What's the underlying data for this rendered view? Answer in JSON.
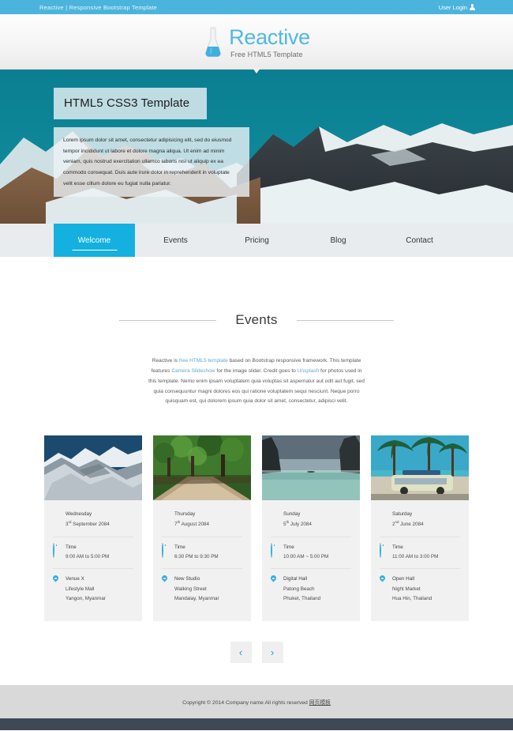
{
  "topbar": {
    "tagline": "Reactive | Responsive Bootstrap Template",
    "login_label": "User Login",
    "login_icon": "user-icon",
    "bg_color": "#4BB4DC"
  },
  "header": {
    "logo_icon": "flask-icon",
    "brand": "Reactive",
    "tagline": "Free HTML5 Template",
    "brand_color": "#4FB8E4"
  },
  "hero": {
    "caption_title": "HTML5 CSS3 Template",
    "caption_body": "Lorem ipsum dolor sit amet, consectetur adipisicing elit, sed do eiusmod tempor incididunt ut labore et dolore magna aliqua. Ut enim ad minim veniam, quis nostrud exercitation ullamco laboris nisi ut aliquip ex ea commodo consequat. Duis aute irure dolor in reprehenderit in voluptate velit esse cillum dolore eu fugiat nulla pariatur.",
    "image_alt": "snowy-mountain-range"
  },
  "nav": {
    "active_color": "#14B1E0",
    "items": [
      {
        "label": "Welcome",
        "active": true
      },
      {
        "label": "Events",
        "active": false
      },
      {
        "label": "Pricing",
        "active": false
      },
      {
        "label": "Blog",
        "active": false
      },
      {
        "label": "Contact",
        "active": false
      }
    ]
  },
  "events": {
    "title": "Events",
    "intro_parts": {
      "p1": "Reactive is ",
      "link1": "free HTML5 template",
      "p2": " based on Bootstrap responsive framework. This template features ",
      "link2": "Camera Slideshow",
      "p3": " for the image slider. Credit goes to ",
      "link3": "Unsplash",
      "p4": " for photos used in this template. Nemo enim ipsam voluptatem quia voluptas sit aspernatur aut odit aut fugit, sed quia consequuntur magni dolores eos qui ratione voluptatem sequi nesciunt. Neque porro quisquam est, qui dolorem ipsum quia dolor sit amet, consectetur, adipisci velit."
    },
    "time_label": "Time",
    "cards": [
      {
        "image_alt": "snowy-mountains",
        "day": "Wednesday",
        "date_num": "3",
        "date_sup": "rd",
        "date_rest": " September 2084",
        "time": "9:00 AM to 5:00 PM",
        "venue": "Venue X",
        "address": "Lifestyle Mall",
        "city": "Yangon, Myanmar"
      },
      {
        "image_alt": "forest-road",
        "day": "Thursday",
        "date_num": "7",
        "date_sup": "th",
        "date_rest": " August 2084",
        "time": "6:30 PM to 9:30 PM",
        "venue": "New Studio",
        "address": "Walking Street",
        "city": "Mandalay, Myanmar"
      },
      {
        "image_alt": "lagoon-cliffs",
        "day": "Sunday",
        "date_num": "5",
        "date_sup": "th",
        "date_rest": " July 2084",
        "time": "10:00 AM ~ 5:00 PM",
        "venue": "Digital Hall",
        "address": "Patong Beach",
        "city": "Phuket, Thailand"
      },
      {
        "image_alt": "palm-beach-van",
        "day": "Saturday",
        "date_num": "2",
        "date_sup": "nd",
        "date_rest": " June 2084",
        "time": "11:00 AM to 3:00 PM",
        "venue": "Open Hall",
        "address": "Night Market",
        "city": "Hua Hin, Thailand"
      }
    ],
    "pager": {
      "prev": "‹",
      "next": "›",
      "arrow_color": "#11A7DE"
    }
  },
  "footer": {
    "copyright": "Copyright © 2014 Company name All rights reserved ",
    "credit_link": "网页模板"
  }
}
